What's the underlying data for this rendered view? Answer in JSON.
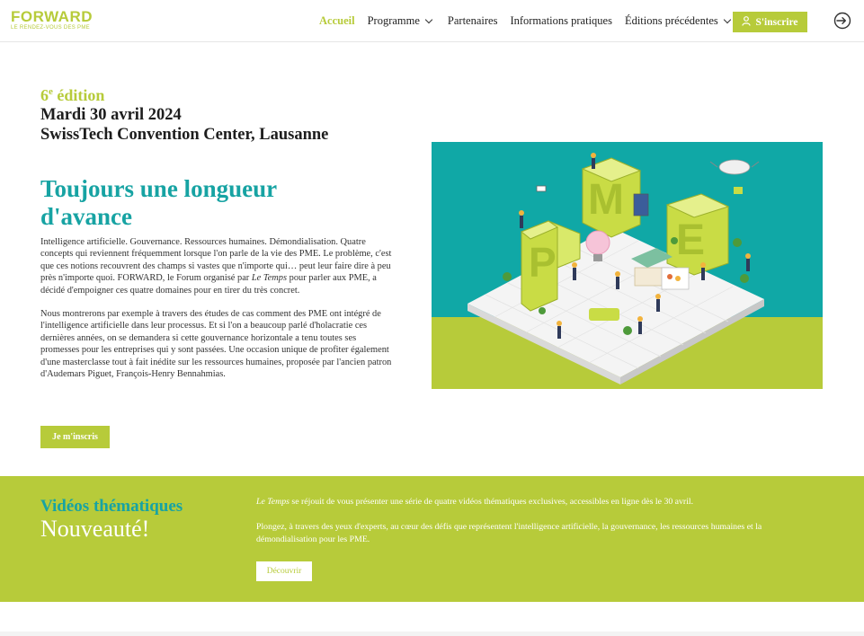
{
  "header": {
    "logo": {
      "main": "FORWARD",
      "sub": "LE RENDEZ-VOUS DES PME"
    },
    "nav": [
      {
        "label": "Accueil",
        "active": true,
        "dropdown": false
      },
      {
        "label": "Programme",
        "active": false,
        "dropdown": true
      },
      {
        "label": "Partenaires",
        "active": false,
        "dropdown": false
      },
      {
        "label": "Informations pratiques",
        "active": false,
        "dropdown": false
      },
      {
        "label": "Éditions précédentes",
        "active": false,
        "dropdown": true
      }
    ],
    "register_label": "S'inscrire",
    "register_icon": "user-icon",
    "login_icon": "login-icon"
  },
  "hero": {
    "edition_number": "6",
    "edition_suffix": "e",
    "edition_word": "édition",
    "date": "Mardi 30 avril 2024",
    "venue": "SwissTech Convention Center, Lausanne",
    "title": "Toujours une longueur d'avance",
    "paragraph1_a": "Intelligence artificielle. Gouvernance. Ressources humaines. Démondialisation. Quatre concepts qui reviennent fréquemment lorsque l'on parle de la vie des PME. Le problème, c'est que ces notions recouvrent des champs si vastes que n'importe qui… peut leur faire dire à peu près n'importe quoi. FORWARD, le Forum organisé par ",
    "paragraph1_em": "Le Temps",
    "paragraph1_b": " pour parler aux PME, a décidé d'empoigner ces quatre domaines pour en tirer du très concret.",
    "paragraph2": "Nous montrerons par exemple à travers des études de cas comment des PME ont intégré de l'intelligence artificielle dans leur processus. Et si l'on a beaucoup parlé d'holacratie ces dernières années, on se demandera si cette gouvernance horizontale a tenu toutes ses promesses pour les entreprises qui y sont passées. Une occasion unique de profiter également d'une masterclasse tout à fait inédite sur les ressources humaines, proposée par l'ancien patron d'Audemars Piguet, François-Henry Bennahmias.",
    "cta_label": "Je m'inscris",
    "illustration_letters": [
      "P",
      "M",
      "E"
    ]
  },
  "videos": {
    "title": "Vidéos thématiques",
    "subtitle": "Nouveauté!",
    "text1_em": "Le Temps",
    "text1": " se réjouit de vous présenter une série de quatre vidéos thématiques exclusives, accessibles en ligne dès le 30 avril.",
    "text2": "Plongez, à travers des yeux d'experts, au cœur des défis que représentent l'intelligence artificielle, la gouvernance, les ressources humaines et la démondialisation pour les PME.",
    "button_label": "Découvrir"
  },
  "colors": {
    "brand_green": "#b7cb3a",
    "teal": "#17a3a3",
    "illustration_bg": "#10a8a6"
  }
}
